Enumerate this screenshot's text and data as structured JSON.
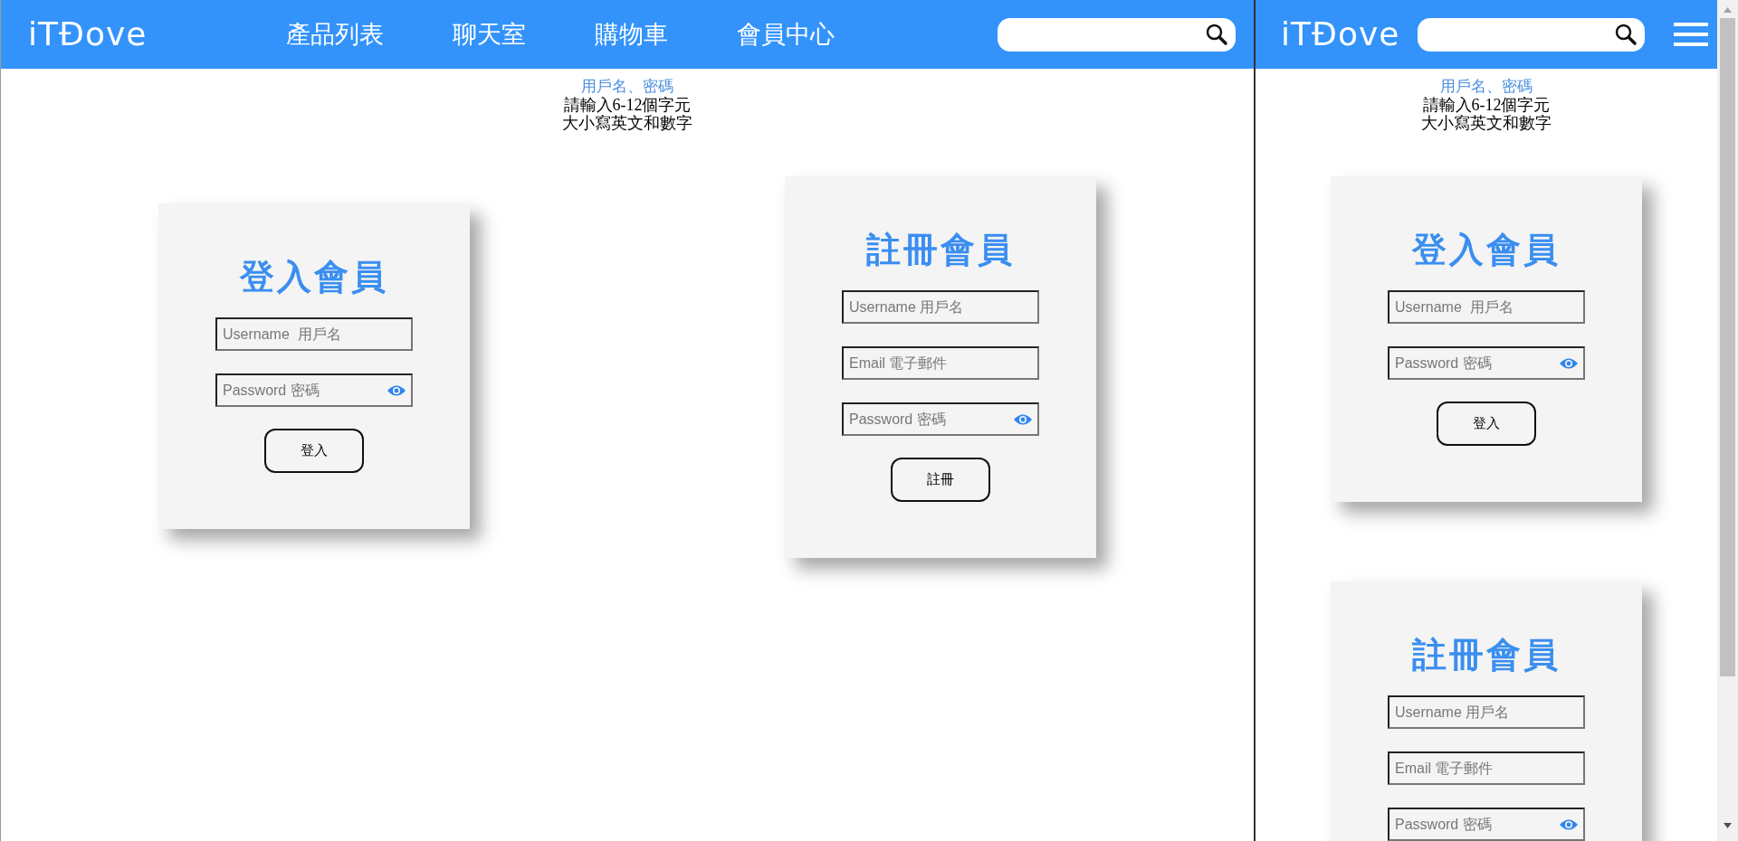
{
  "desktop": {
    "header": {
      "logo": "iTĐove",
      "nav_items": [
        "產品列表",
        "聊天室",
        "購物車",
        "會員中心"
      ]
    },
    "hint": {
      "title": "用戶名、密碼",
      "lines": [
        "請輸入6-12個字元",
        "大小寫英文和數字"
      ]
    },
    "cards": [
      {
        "title": "登入會員",
        "fields": [
          {
            "kind": "text",
            "placeholder": "Username  用戶名"
          },
          {
            "kind": "password",
            "placeholder": "Password 密碼"
          }
        ],
        "button": "登入"
      },
      {
        "title": "註冊會員",
        "fields": [
          {
            "kind": "text",
            "placeholder": "Username 用戶名"
          },
          {
            "kind": "text",
            "placeholder": "Email 電子郵件"
          },
          {
            "kind": "password",
            "placeholder": "Password 密碼"
          }
        ],
        "button": "註冊"
      }
    ]
  },
  "mobile": {
    "header": {
      "logo": "iTĐove"
    },
    "hint": {
      "title": "用戶名、密碼",
      "lines": [
        "請輸入6-12個字元",
        "大小寫英文和數字"
      ]
    },
    "cards": [
      {
        "title": "登入會員",
        "fields": [
          {
            "kind": "text",
            "placeholder": "Username  用戶名"
          },
          {
            "kind": "password",
            "placeholder": "Password 密碼"
          }
        ],
        "button": "登入"
      },
      {
        "title": "註冊會員",
        "fields": [
          {
            "kind": "text",
            "placeholder": "Username 用戶名"
          },
          {
            "kind": "text",
            "placeholder": "Email 電子郵件"
          },
          {
            "kind": "password",
            "placeholder": "Password 密碼"
          }
        ]
      }
    ]
  }
}
